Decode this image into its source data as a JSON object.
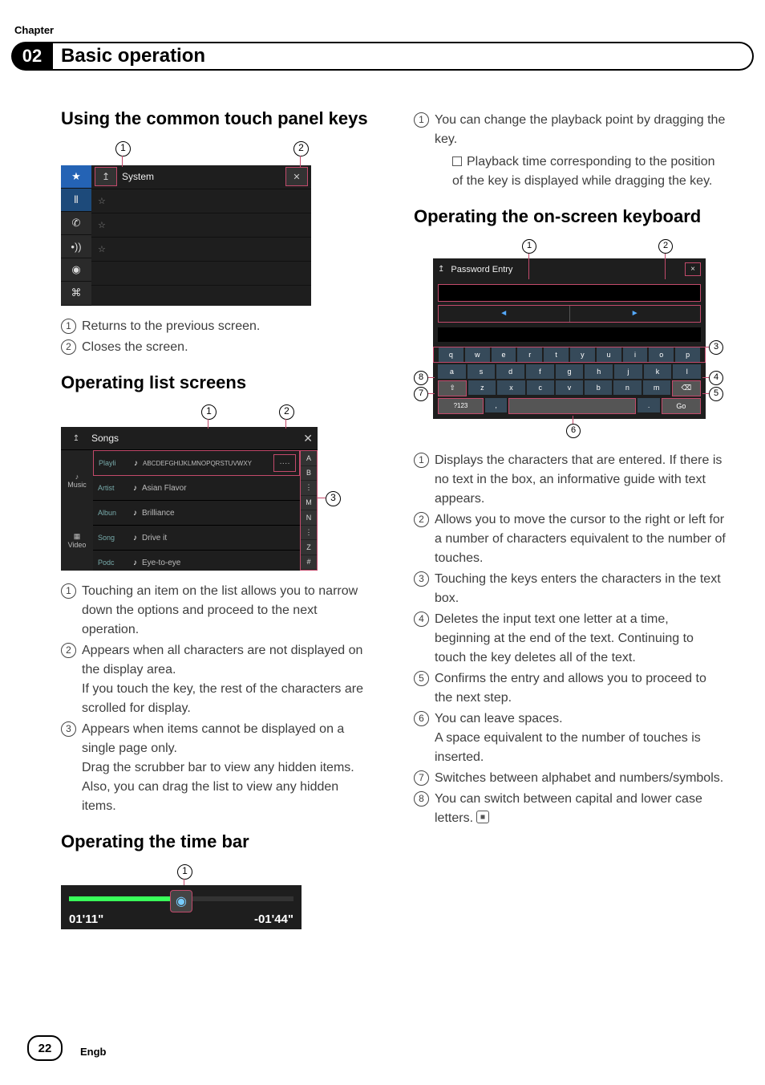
{
  "chapter_label": "Chapter",
  "chapter_num": "02",
  "header_title": "Basic operation",
  "page_num": "22",
  "lang": "Engb",
  "left": {
    "sec1_title": "Using the common touch panel keys",
    "fig1": {
      "c1": "1",
      "c2": "2",
      "title": "System",
      "star": "★",
      "home": "⌂",
      "phone": "✆",
      "mic": "∿",
      "speaker": "•))",
      "disc": "◉",
      "link": "⌘",
      "row_star": "☆"
    },
    "list1": {
      "i1": "Returns to the previous screen.",
      "i2": "Closes the screen."
    },
    "sec2_title": "Operating list screens",
    "fig2": {
      "c1": "1",
      "c2": "2",
      "c3": "3",
      "title": "Songs",
      "left_music": "Music",
      "left_video": "Video",
      "row1_cat": "Playli",
      "row1_txt": "ABCDEFGHIJKLMNOPQRSTUVWXY",
      "row2_cat": "Artist",
      "row2_txt": "Asian Flavor",
      "row3_cat": "Albun",
      "row3_txt": "Brilliance",
      "row4_cat": "Song",
      "row4_txt": "Drive it",
      "row5_cat": "Podc",
      "row5_txt": "Eye-to-eye",
      "sb_a": "A",
      "sb_b": "B",
      "sb_m": "M",
      "sb_n": "N",
      "sb_z": "Z",
      "sb_hash": "#"
    },
    "list2": {
      "i1": "Touching an item on the list allows you to narrow down the options and proceed to the next operation.",
      "i2a": "Appears when all characters are not displayed on the display area.",
      "i2b": "If you touch the key, the rest of the characters are scrolled for display.",
      "i3a": "Appears when items cannot be displayed on a single page only.",
      "i3b": "Drag the scrubber bar to view any hidden items.",
      "i3c": "Also, you can drag the list to view any hidden items."
    },
    "sec3_title": "Operating the time bar",
    "fig3": {
      "c1": "1",
      "t_left": "01'11\"",
      "t_right": "-01'44\""
    }
  },
  "right": {
    "top_list": {
      "i1": "You can change the playback point by dragging the key.",
      "i1_sub": "Playback time corresponding to the position of the key is displayed while dragging the key."
    },
    "sec_kb_title": "Operating the on-screen keyboard",
    "kb": {
      "c1": "1",
      "c2": "2",
      "c3": "3",
      "c4": "4",
      "c5": "5",
      "c6": "6",
      "c7": "7",
      "c8": "8",
      "title": "Password Entry",
      "close": "×",
      "arrow_l": "◄",
      "arrow_r": "►",
      "r1": [
        "q",
        "w",
        "e",
        "r",
        "t",
        "y",
        "u",
        "i",
        "o",
        "p"
      ],
      "r2": [
        "a",
        "s",
        "d",
        "f",
        "g",
        "h",
        "j",
        "k",
        "l"
      ],
      "r3": [
        "⇧",
        "z",
        "x",
        "c",
        "v",
        "b",
        "n",
        "m",
        "⌫"
      ],
      "r4_left": "?123",
      "r4_mid": ",",
      "r4_space": " ",
      "r4_dot": ".",
      "r4_go": "Go"
    },
    "kb_list": {
      "i1": "Displays the characters that are entered. If there is no text in the box, an informative guide with text appears.",
      "i2": "Allows you to move the cursor to the right or left for a number of characters equivalent to the number of touches.",
      "i3": "Touching the keys enters the characters in the text box.",
      "i4": "Deletes the input text one letter at a time, beginning at the end of the text. Continuing to touch the key deletes all of the text.",
      "i5": "Confirms the entry and allows you to proceed to the next step.",
      "i6a": "You can leave spaces.",
      "i6b": "A space equivalent to the number of touches is inserted.",
      "i7": "Switches between alphabet and numbers/symbols.",
      "i8": "You can switch between capital and lower case letters."
    }
  }
}
